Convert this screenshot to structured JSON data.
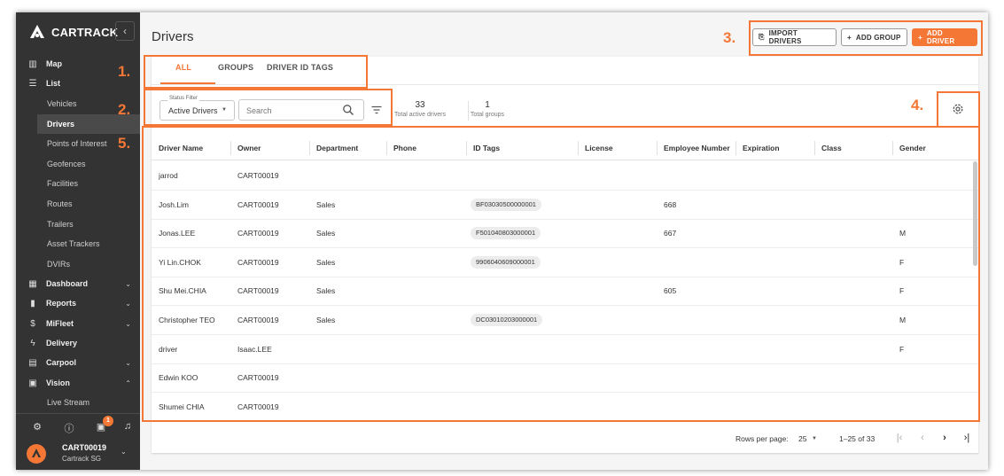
{
  "brand": {
    "name": "CARTRACK"
  },
  "sidebar": {
    "items": [
      {
        "label": "Map",
        "icon": "map-icon",
        "chevron": ""
      },
      {
        "label": "List",
        "icon": "list-icon",
        "chevron": ""
      },
      {
        "label": "Dashboard",
        "icon": "dashboard-icon",
        "chevron": "⌄"
      },
      {
        "label": "Reports",
        "icon": "bar-chart-icon",
        "chevron": "⌄"
      },
      {
        "label": "MiFleet",
        "icon": "dollar-icon",
        "chevron": "⌄"
      },
      {
        "label": "Delivery",
        "icon": "bolt-icon",
        "chevron": ""
      },
      {
        "label": "Carpool",
        "icon": "calendar-icon",
        "chevron": "⌄"
      },
      {
        "label": "Vision",
        "icon": "video-icon",
        "chevron": "⌃"
      }
    ],
    "list_sub": [
      "Vehicles",
      "Drivers",
      "Points of Interest",
      "Geofences",
      "Facilities",
      "Routes",
      "Trailers",
      "Asset Trackers",
      "DVIRs"
    ],
    "vision_sub": [
      "Live Stream"
    ],
    "active_sub": "Drivers",
    "notification_count": "1",
    "account": {
      "name": "CART00019",
      "subtitle": "Cartrack SG"
    }
  },
  "header": {
    "title": "Drivers",
    "import_label": "IMPORT DRIVERS",
    "add_group_label": "ADD GROUP",
    "add_driver_label": "ADD DRIVER"
  },
  "tabs": [
    {
      "label": "ALL",
      "active": true
    },
    {
      "label": "GROUPS",
      "active": false
    },
    {
      "label": "DRIVER ID TAGS",
      "active": false
    }
  ],
  "toolbar": {
    "status_filter_label": "Status Filter",
    "status_filter_value": "Active Drivers",
    "search_placeholder": "Search",
    "stats": [
      {
        "value": "33",
        "label": "Total active drivers"
      },
      {
        "value": "1",
        "label": "Total groups"
      }
    ]
  },
  "table": {
    "columns": [
      "Driver Name",
      "Owner",
      "Department",
      "Phone",
      "ID Tags",
      "License",
      "Employee Number",
      "Expiration",
      "Class",
      "Gender"
    ],
    "rows": [
      {
        "name": "jarrod",
        "owner": "CART00019",
        "department": "",
        "phone": "",
        "id_tag": "",
        "license": "",
        "employee_number": "",
        "expiration": "",
        "class": "",
        "gender": ""
      },
      {
        "name": "Josh.Lim",
        "owner": "CART00019",
        "department": "Sales",
        "phone": "",
        "id_tag": "BF03030500000001",
        "license": "",
        "employee_number": "668",
        "expiration": "",
        "class": "",
        "gender": ""
      },
      {
        "name": "Jonas.LEE",
        "owner": "CART00019",
        "department": "Sales",
        "phone": "",
        "id_tag": "F501040803000001",
        "license": "",
        "employee_number": "667",
        "expiration": "",
        "class": "",
        "gender": "M"
      },
      {
        "name": "Yi Lin.CHOK",
        "owner": "CART00019",
        "department": "Sales",
        "phone": "",
        "id_tag": "9906040609000001",
        "license": "",
        "employee_number": "",
        "expiration": "",
        "class": "",
        "gender": "F"
      },
      {
        "name": "Shu Mei.CHIA",
        "owner": "CART00019",
        "department": "Sales",
        "phone": "",
        "id_tag": "",
        "license": "",
        "employee_number": "605",
        "expiration": "",
        "class": "",
        "gender": "F"
      },
      {
        "name": "Christopher TEO",
        "owner": "CART00019",
        "department": "Sales",
        "phone": "",
        "id_tag": "DC03010203000001",
        "license": "",
        "employee_number": "",
        "expiration": "",
        "class": "",
        "gender": "M"
      },
      {
        "name": "driver",
        "owner": "Isaac.LEE",
        "department": "",
        "phone": "",
        "id_tag": "",
        "license": "",
        "employee_number": "",
        "expiration": "",
        "class": "",
        "gender": "F"
      },
      {
        "name": "Edwin KOO",
        "owner": "CART00019",
        "department": "",
        "phone": "",
        "id_tag": "",
        "license": "",
        "employee_number": "",
        "expiration": "",
        "class": "",
        "gender": ""
      },
      {
        "name": "Shumei CHIA",
        "owner": "CART00019",
        "department": "",
        "phone": "",
        "id_tag": "",
        "license": "",
        "employee_number": "",
        "expiration": "",
        "class": "",
        "gender": ""
      }
    ]
  },
  "pagination": {
    "rows_per_page_label": "Rows per page:",
    "rows_per_page": "25",
    "range": "1–25 of 33"
  },
  "annotations": [
    {
      "label": "1."
    },
    {
      "label": "2."
    },
    {
      "label": "3."
    },
    {
      "label": "4."
    },
    {
      "label": "5."
    }
  ],
  "colors": {
    "accent": "#f47735",
    "sidebar_bg": "#333333",
    "active_item_bg": "#4a4a4a"
  }
}
